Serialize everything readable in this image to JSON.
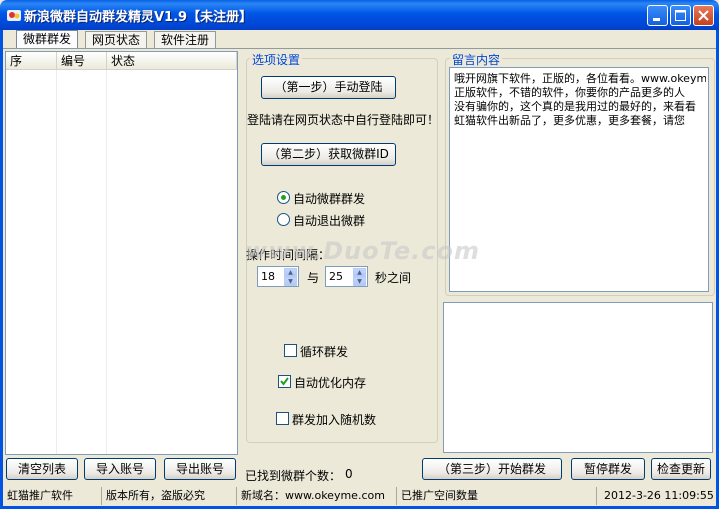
{
  "window": {
    "title": "新浪微群自动群发精灵V1.9【未注册】"
  },
  "tabs": [
    {
      "label": "微群群发"
    },
    {
      "label": "网页状态"
    },
    {
      "label": "软件注册"
    }
  ],
  "list": {
    "columns": [
      "序",
      "编号",
      "状态"
    ]
  },
  "left_buttons": {
    "clear": "清空列表",
    "import": "导入账号",
    "export": "导出账号"
  },
  "options": {
    "group_label": "选项设置",
    "step1": "（第一步）手动登陆",
    "login_hint": "登陆请在网页状态中自行登陆即可！",
    "step2": "（第二步）获取微群ID",
    "radio_auto_send": "自动微群群发",
    "radio_auto_exit": "自动退出微群",
    "interval_label": "操作时间间隔：",
    "interval_min": "18",
    "interval_and": "与",
    "interval_max": "25",
    "interval_unit": "秒之间",
    "loop": "循环群发",
    "optimize": "自动优化内存",
    "random": "群发加入随机数"
  },
  "message": {
    "group_label": "留言内容",
    "lines": [
      "哦开网旗下软件，正版的，各位看看。www.okeyme.com",
      "正版软件，不错的软件，你要你的产品更多的人",
      "没有骗你的，这个真的是我用过的最好的，来看看",
      "虹猫软件出新品了，更多优惠，更多套餐，请您"
    ]
  },
  "bottom": {
    "found_label": "已找到微群个数：",
    "found_count": "0",
    "step3": "（第三步）开始群发",
    "pause": "暂停群发",
    "check_update": "检查更新"
  },
  "statusbar": {
    "s1": "虹猫推广软件",
    "s2": "版本所有，盗版必究",
    "s3": "新域名：www.okeyme.com",
    "s4": "已推广空间数量",
    "s5": "2012-3-26 11:09:55"
  },
  "watermark": "www.DuoTe.com",
  "colors": {
    "titlebar": "#0055e5",
    "accent": "#0046d5",
    "check": "#21a121"
  }
}
